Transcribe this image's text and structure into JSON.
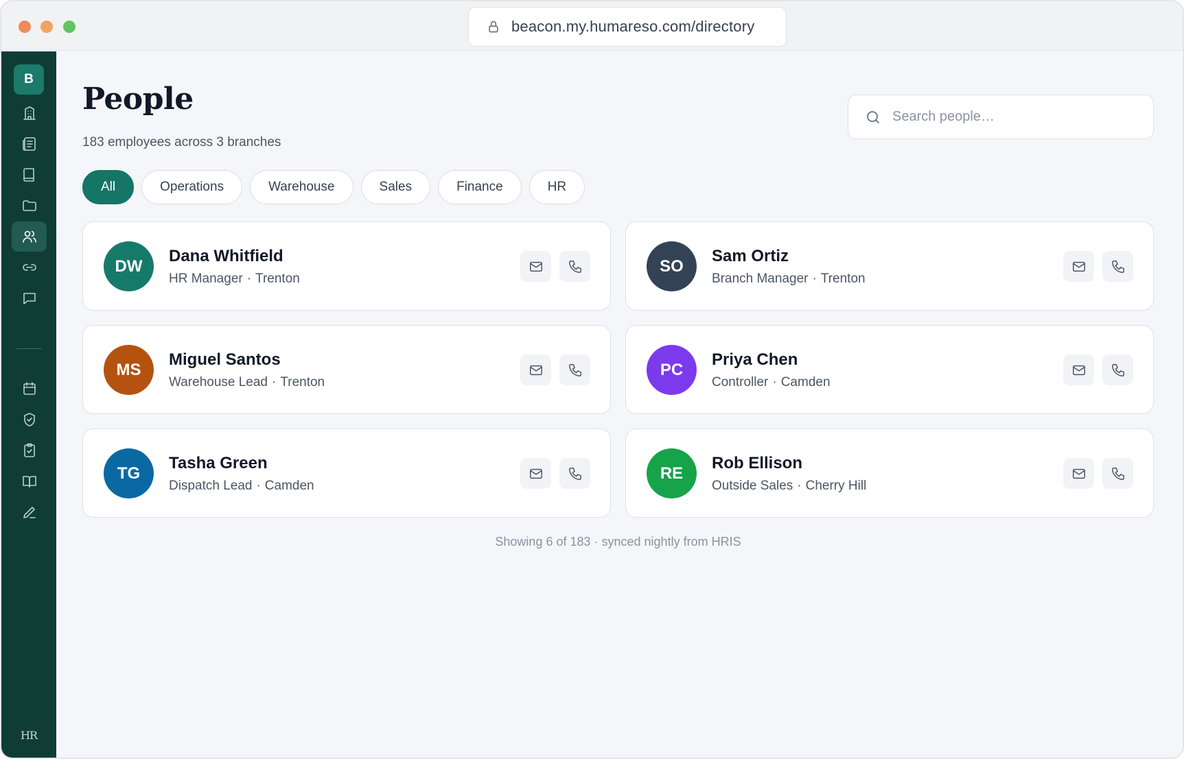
{
  "browser": {
    "url": "beacon.my.humareso.com/directory"
  },
  "sidebar": {
    "logo_letter": "B",
    "nav_top": [
      {
        "icon": "building-icon",
        "active": false
      },
      {
        "icon": "newspaper-icon",
        "active": false
      },
      {
        "icon": "book-icon",
        "active": false
      },
      {
        "icon": "folder-icon",
        "active": false
      },
      {
        "icon": "people-icon",
        "active": true
      },
      {
        "icon": "link-icon",
        "active": false
      },
      {
        "icon": "chat-icon",
        "active": false
      }
    ],
    "nav_bottom": [
      {
        "icon": "calendar-icon",
        "active": false
      },
      {
        "icon": "shield-icon",
        "active": false
      },
      {
        "icon": "clipboard-icon",
        "active": false
      },
      {
        "icon": "open-book-icon",
        "active": false
      },
      {
        "icon": "pen-icon",
        "active": false
      }
    ],
    "footer_mark": "HR"
  },
  "header": {
    "title": "People",
    "subtitle": "183 employees across 3 branches",
    "search_placeholder": "Search people…"
  },
  "filters": [
    {
      "label": "All",
      "active": true
    },
    {
      "label": "Operations",
      "active": false
    },
    {
      "label": "Warehouse",
      "active": false
    },
    {
      "label": "Sales",
      "active": false
    },
    {
      "label": "Finance",
      "active": false
    },
    {
      "label": "HR",
      "active": false
    }
  ],
  "people": [
    {
      "initials": "DW",
      "name": "Dana Whitfield",
      "role": "HR Manager",
      "location": "Trenton",
      "color": "#167a6b"
    },
    {
      "initials": "SO",
      "name": "Sam Ortiz",
      "role": "Branch Manager",
      "location": "Trenton",
      "color": "#344256"
    },
    {
      "initials": "MS",
      "name": "Miguel Santos",
      "role": "Warehouse Lead",
      "location": "Trenton",
      "color": "#b4530f"
    },
    {
      "initials": "PC",
      "name": "Priya Chen",
      "role": "Controller",
      "location": "Camden",
      "color": "#7c3aed"
    },
    {
      "initials": "TG",
      "name": "Tasha Green",
      "role": "Dispatch Lead",
      "location": "Camden",
      "color": "#0a69a3"
    },
    {
      "initials": "RE",
      "name": "Rob Ellison",
      "role": "Outside Sales",
      "location": "Cherry Hill",
      "color": "#16a34a"
    }
  ],
  "meta_separator": "·",
  "footer": {
    "note": "Showing 6 of 183 · synced nightly from HRIS"
  },
  "colors": {
    "sidebar": "#0f3d36",
    "accent": "#157566",
    "background": "#f4f6f9"
  }
}
